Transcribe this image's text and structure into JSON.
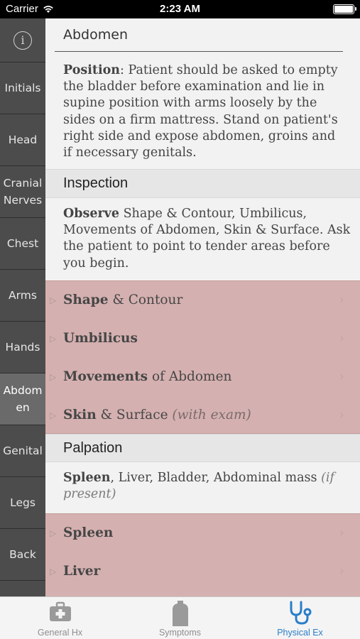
{
  "status": {
    "carrier": "Carrier",
    "time": "2:23 AM"
  },
  "sidebar": {
    "info_glyph": "i",
    "items": [
      {
        "label": "Initials"
      },
      {
        "label": "Head"
      },
      {
        "label": "Cranial Nerves"
      },
      {
        "label": "Chest"
      },
      {
        "label": "Arms"
      },
      {
        "label": "Hands"
      },
      {
        "label": "Abdomen",
        "active": true
      },
      {
        "label": "Genital"
      },
      {
        "label": "Legs"
      },
      {
        "label": "Back"
      }
    ]
  },
  "main": {
    "title": "Abdomen",
    "position": {
      "label": "Position",
      "text": ": Patient should be asked to empty the bladder before examination and lie in supine position with arms loosely by the sides on a firm mattress. Stand on patient's right side and expose abdomen, groins and if necessary genitals."
    },
    "inspection": {
      "header": "Inspection",
      "intro_bold": "Observe",
      "intro_text": " Shape & Contour, Umbilicus, Movements of Abdomen, Skin & Surface. Ask the patient to point to tender areas before you begin.",
      "rows": [
        {
          "bold": "Shape",
          "rest": " & Contour",
          "note": ""
        },
        {
          "bold": "Umbilicus",
          "rest": "",
          "note": ""
        },
        {
          "bold": "Movements",
          "rest": " of Abdomen",
          "note": ""
        },
        {
          "bold": "Skin",
          "rest": " & Surface ",
          "note": "(with exam)"
        }
      ]
    },
    "palpation": {
      "header": "Palpation",
      "intro_bold": "Spleen",
      "intro_text": ", Liver, Bladder, Abdominal mass ",
      "intro_note": "(if present)",
      "rows": [
        {
          "bold": "Spleen",
          "rest": "",
          "note": ""
        },
        {
          "bold": "Liver",
          "rest": "",
          "note": ""
        }
      ]
    }
  },
  "tabs": [
    {
      "label": "General Hx",
      "icon": "first-aid-kit-icon"
    },
    {
      "label": "Symptoms",
      "icon": "body-silhouette-icon"
    },
    {
      "label": "Physical Ex",
      "icon": "stethoscope-icon",
      "active": true
    }
  ],
  "colors": {
    "accent": "#2a7ec8",
    "sidebar": "#4c4c4c",
    "highlight_rows": "#d5b0b0"
  }
}
